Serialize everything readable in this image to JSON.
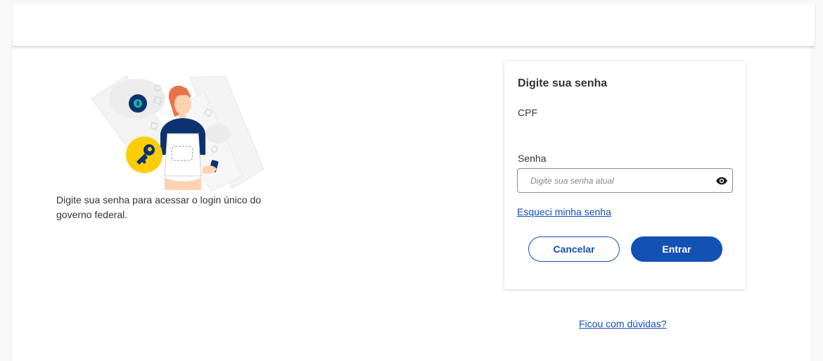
{
  "intro": {
    "text": "Digite sua senha para acessar o login único do governo federal."
  },
  "login_card": {
    "title": "Digite sua senha",
    "cpf_label": "CPF",
    "cpf_value": "",
    "password_label": "Senha",
    "password_placeholder": "Digite sua senha atual",
    "password_value": "",
    "show_password_icon": "eye-icon",
    "forgot_password_link": "Esqueci minha senha",
    "cancel_button": "Cancelar",
    "enter_button": "Entrar"
  },
  "help_link": "Ficou com dúvidas?",
  "colors": {
    "primary": "#1351b4",
    "text": "#333333",
    "accent_yellow": "#ffcd07",
    "hair": "#e8734a"
  }
}
